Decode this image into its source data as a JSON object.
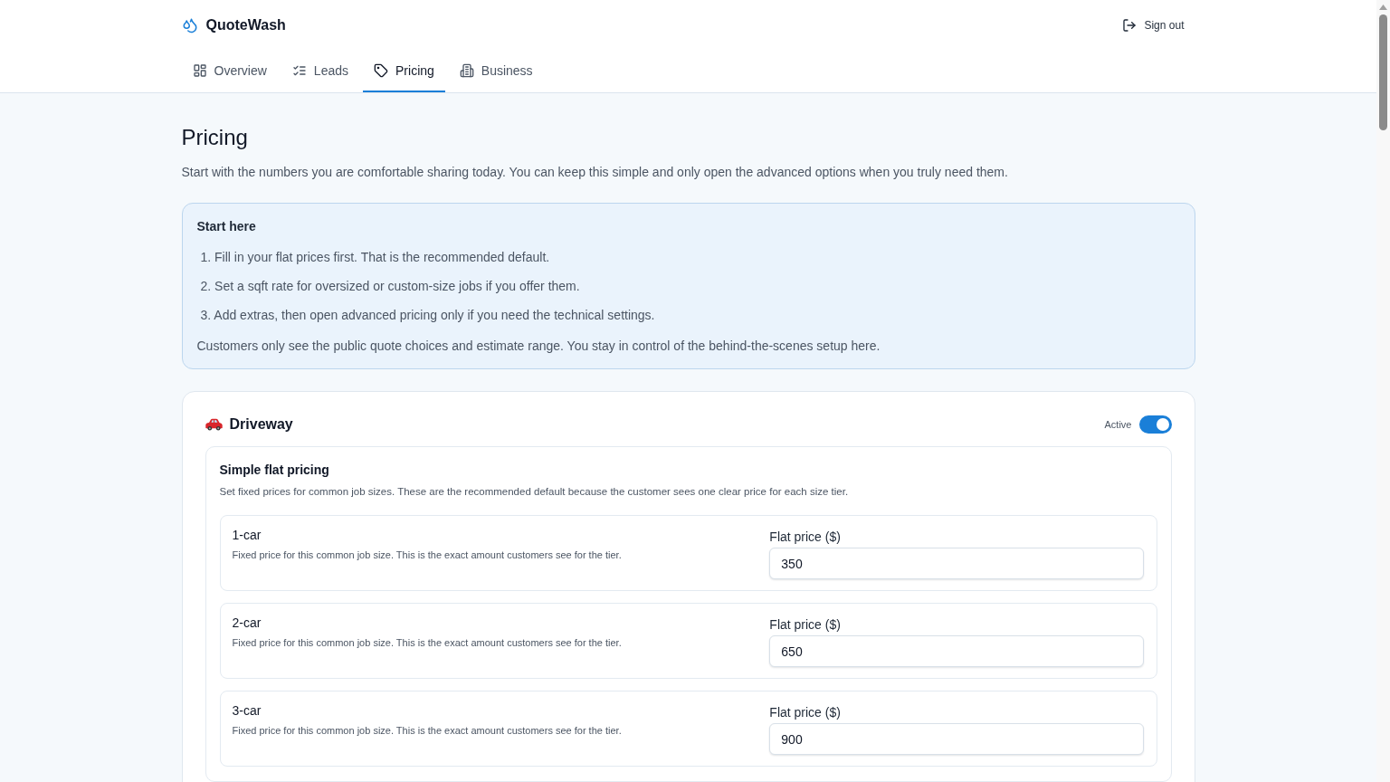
{
  "header": {
    "brand": "QuoteWash",
    "sign_out": "Sign out"
  },
  "tabs": [
    {
      "label": "Overview",
      "selected": false
    },
    {
      "label": "Leads",
      "selected": false
    },
    {
      "label": "Pricing",
      "selected": true
    },
    {
      "label": "Business",
      "selected": false
    }
  ],
  "page": {
    "title": "Pricing",
    "intro": "Start with the numbers you are comfortable sharing today. You can keep this simple and only open the advanced options when you truly need them."
  },
  "start_here": {
    "title": "Start here",
    "steps": [
      "1. Fill in your flat prices first. That is the recommended default.",
      "2. Set a sqft rate for oversized or custom-size jobs if you offer them.",
      "3. Add extras, then open advanced pricing only if you need the technical settings."
    ],
    "note": "Customers only see the public quote choices and estimate range. You stay in control of the behind-the-scenes setup here."
  },
  "services": [
    {
      "name": "Driveway",
      "status_label": "Active",
      "active": true,
      "flat_pricing": {
        "title": "Simple flat pricing",
        "description": "Set fixed prices for common job sizes. These are the recommended default because the customer sees one clear price for each size tier.",
        "tiers": [
          {
            "name": "1-car",
            "description": "Fixed price for this common job size. This is the exact amount customers see for the tier.",
            "field_label": "Flat price ($)",
            "value": "350"
          },
          {
            "name": "2-car",
            "description": "Fixed price for this common job size. This is the exact amount customers see for the tier.",
            "field_label": "Flat price ($)",
            "value": "650"
          },
          {
            "name": "3-car",
            "description": "Fixed price for this common job size. This is the exact amount customers see for the tier.",
            "field_label": "Flat price ($)",
            "value": "900"
          }
        ]
      }
    }
  ]
}
